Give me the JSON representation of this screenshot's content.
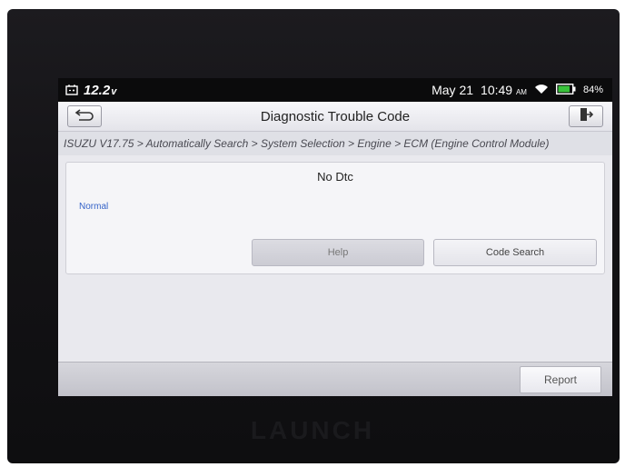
{
  "status_bar": {
    "voltage": "12.2",
    "voltage_unit": "v",
    "date": "May 21",
    "time": "10:49",
    "ampm": "AM",
    "battery_percent": "84%",
    "icons": [
      "battery-charger-icon",
      "wifi-icon",
      "battery-icon"
    ]
  },
  "header": {
    "title": "Diagnostic Trouble Code",
    "back_icon": "back-arrow-icon",
    "exit_icon": "exit-door-icon"
  },
  "breadcrumb": "ISUZU V17.75 > Automatically Search > System Selection > Engine > ECM (Engine Control Module)",
  "panel": {
    "dtc_message": "No Dtc",
    "status": "Normal",
    "help_label": "Help",
    "code_search_label": "Code Search"
  },
  "footer": {
    "report_label": "Report"
  },
  "device": {
    "brand": "LAUNCH"
  },
  "colors": {
    "status_text": "#3563c8",
    "status_bar_bg": "#0b0b0c",
    "battery_fill": "#38c23a"
  }
}
